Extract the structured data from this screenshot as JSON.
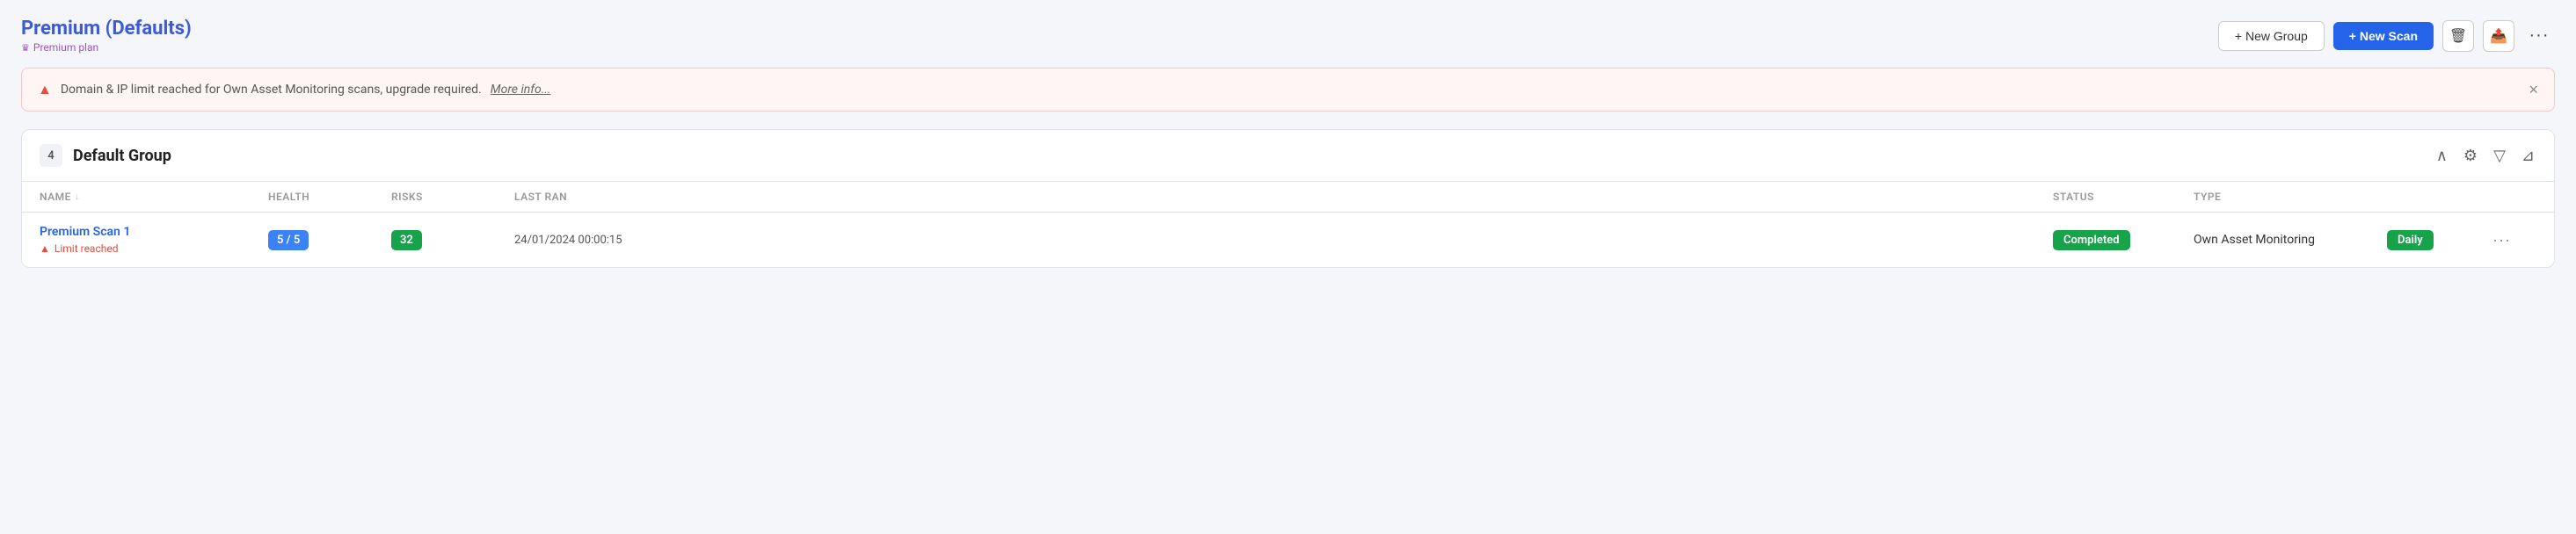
{
  "header": {
    "title": "Premium (Defaults)",
    "plan": "Premium plan",
    "buttons": {
      "new_group": "+ New Group",
      "new_scan": "+ New Scan",
      "more": "···"
    }
  },
  "alert": {
    "message": "Domain & IP limit reached for Own Asset Monitoring scans, upgrade required.",
    "link_text": "More info...",
    "close": "×"
  },
  "group": {
    "count": "4",
    "name": "Default Group"
  },
  "table": {
    "columns": [
      {
        "label": "NAME",
        "sort": true
      },
      {
        "label": "HEALTH",
        "sort": false
      },
      {
        "label": "RISKS",
        "sort": false
      },
      {
        "label": "LAST RAN",
        "sort": false
      },
      {
        "label": "STATUS",
        "sort": false
      },
      {
        "label": "TYPE",
        "sort": false
      }
    ],
    "rows": [
      {
        "name": "Premium Scan 1",
        "warning": "Limit reached",
        "health": "5 / 5",
        "risks": "32",
        "last_ran": "24/01/2024 00:00:15",
        "status": "Completed",
        "type": "Own Asset Monitoring",
        "frequency": "Daily"
      }
    ]
  },
  "icons": {
    "crown": "♛",
    "warning": "▲",
    "chevron_up": "∧",
    "gear": "⚙",
    "filter": "⌥",
    "pin": "⊿",
    "trash": "🗑",
    "export": "📤",
    "more_horiz": "···",
    "sort_down": "↓",
    "close": "×"
  }
}
